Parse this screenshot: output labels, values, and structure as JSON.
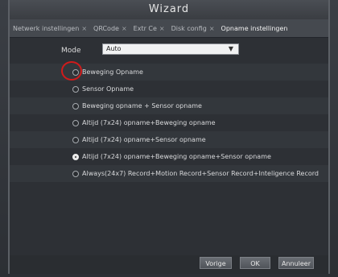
{
  "window": {
    "title": "Wizard"
  },
  "tabs": [
    {
      "label": "Netwerk instellingen",
      "active": false
    },
    {
      "label": "QRCode",
      "active": false
    },
    {
      "label": "Extr Ce",
      "active": false
    },
    {
      "label": "Disk config",
      "active": false
    },
    {
      "label": "Opname instellingen",
      "active": true
    }
  ],
  "tab_close_glyph": "×",
  "mode": {
    "label": "Mode",
    "value": "Auto",
    "icon": "chevron-down-icon"
  },
  "options": [
    {
      "label": "Beweging Opname",
      "selected": false
    },
    {
      "label": "Sensor Opname",
      "selected": false
    },
    {
      "label": "Beweging opname + Sensor opname",
      "selected": false
    },
    {
      "label": "Altijd (7x24) opname+Beweging opname",
      "selected": false
    },
    {
      "label": "Altijd (7x24) opname+Sensor opname",
      "selected": false
    },
    {
      "label": "Altijd (7x24) opname+Beweging opname+Sensor opname",
      "selected": true
    },
    {
      "label": "Always(24x7) Record+Motion Record+Sensor Record+Inteligence Record",
      "selected": false
    }
  ],
  "buttons": {
    "previous": "Vorige",
    "ok": "OK",
    "cancel": "Annuleer"
  },
  "colors": {
    "highlight_circle": "#d11b1b",
    "background": "#2d3035"
  }
}
